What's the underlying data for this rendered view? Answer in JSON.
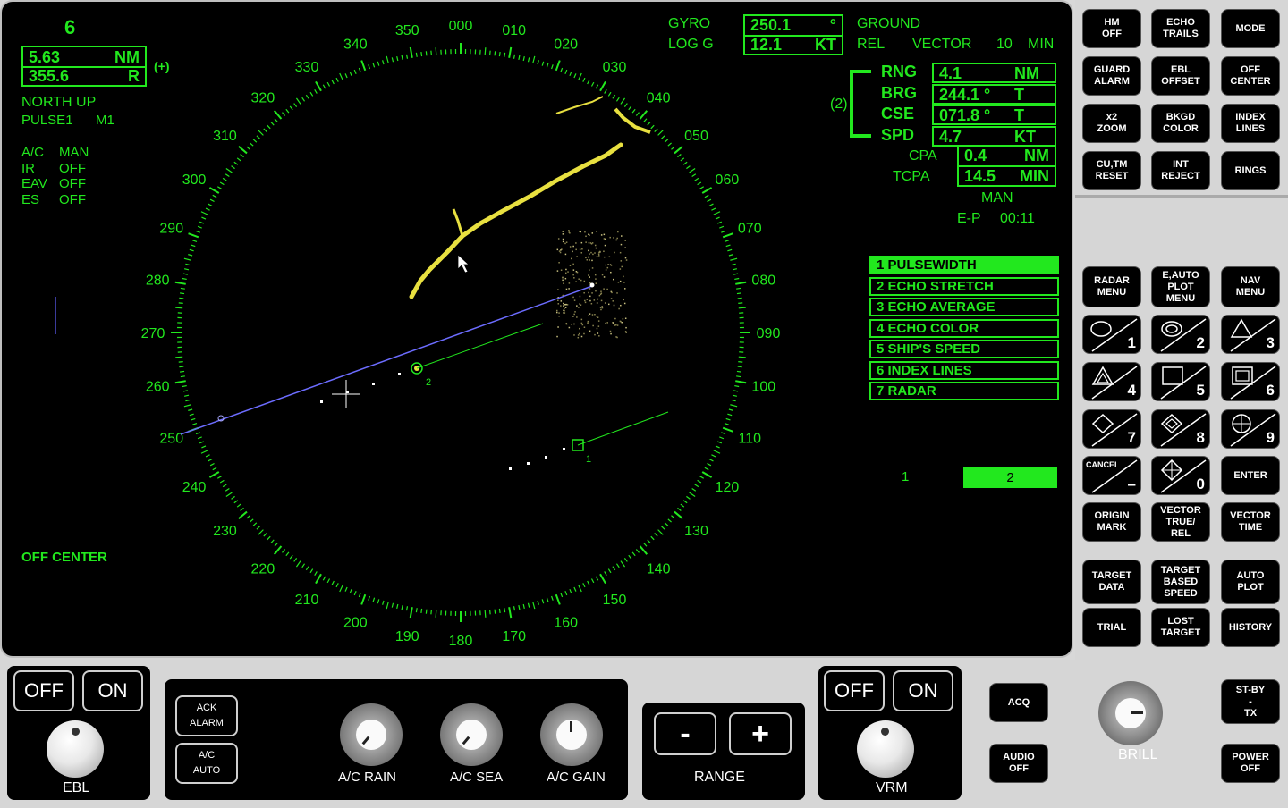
{
  "top_left": {
    "range_scale": "6",
    "range_nm": "5.63",
    "range_nm_unit": "NM",
    "bearing": "355.6",
    "bearing_unit": "R",
    "plus_marker": "(+)",
    "orientation": "NORTH UP",
    "pulse": "PULSE1",
    "mode_m": "M1",
    "settings": [
      {
        "k": "A/C",
        "v": "MAN"
      },
      {
        "k": "IR",
        "v": "OFF"
      },
      {
        "k": "EAV",
        "v": "OFF"
      },
      {
        "k": "ES",
        "v": "OFF"
      }
    ],
    "off_center": "OFF CENTER"
  },
  "heading": {
    "gyro_label": "GYRO",
    "gyro_value": "250.1",
    "gyro_unit": "°",
    "log_label": "LOG G",
    "log_value": "12.1",
    "log_unit": "KT",
    "ground": "GROUND",
    "rel": "REL",
    "vector": "VECTOR",
    "vector_time": "10",
    "vector_unit": "MIN"
  },
  "target": {
    "id": "(2)",
    "rows": [
      {
        "label": "RNG",
        "value": "4.1",
        "unit": "NM"
      },
      {
        "label": "BRG",
        "value": "244.1 °",
        "unit": "T"
      },
      {
        "label": "CSE",
        "value": "071.8 °",
        "unit": "T"
      },
      {
        "label": "SPD",
        "value": "4.7",
        "unit": "KT"
      }
    ],
    "cpa_label": "CPA",
    "cpa_value": "0.4",
    "cpa_unit": "NM",
    "tcpa_label": "TCPA",
    "tcpa_value": "14.5",
    "tcpa_unit": "MIN",
    "man": "MAN",
    "ep_label": "E-P",
    "ep_time": "00:11"
  },
  "menu": {
    "items": [
      "1 PULSEWIDTH",
      "2 ECHO STRETCH",
      "3 ECHO AVERAGE",
      "4 ECHO COLOR",
      "5 SHIP'S SPEED",
      "6 INDEX LINES",
      "7 RADAR"
    ],
    "selected_index": 0,
    "page1": "1",
    "page2": "2"
  },
  "compass": {
    "labels": [
      "000",
      "010",
      "020",
      "030",
      "040",
      "050",
      "060",
      "070",
      "080",
      "090",
      "100",
      "110",
      "120",
      "130",
      "140",
      "150",
      "160",
      "170",
      "180",
      "190",
      "200",
      "210",
      "220",
      "230",
      "240",
      "250",
      "260",
      "270",
      "280",
      "290",
      "300",
      "310",
      "320",
      "330",
      "340",
      "350"
    ]
  },
  "targets_on_screen": {
    "t1": "1",
    "t2": "2"
  },
  "right_buttons": [
    "HM\nOFF",
    "ECHO\nTRAILS",
    "MODE",
    "GUARD\nALARM",
    "EBL\nOFFSET",
    "OFF\nCENTER",
    "x2\nZOOM",
    "BKGD\nCOLOR",
    "INDEX\nLINES",
    "CU,TM\nRESET",
    "INT\nREJECT",
    "RINGS",
    "RADAR\nMENU",
    "E,AUTO\nPLOT\nMENU",
    "NAV\nMENU"
  ],
  "symbol_buttons": {
    "n1": "1",
    "n2": "2",
    "n3": "3",
    "n4": "4",
    "n5": "5",
    "n6": "6",
    "n7": "7",
    "n8": "8",
    "n9": "9",
    "cancel": "CANCEL",
    "cancel_sym": "–",
    "n0": "0",
    "enter": "ENTER"
  },
  "bottom_right_buttons": [
    "ORIGIN\nMARK",
    "VECTOR\nTRUE/\nREL",
    "VECTOR\nTIME",
    "TARGET\nDATA",
    "TARGET\nBASED\nSPEED",
    "AUTO\nPLOT",
    "TRIAL",
    "LOST\nTARGET",
    "HISTORY"
  ],
  "bottom": {
    "ebl_off": "OFF",
    "ebl_on": "ON",
    "ebl_label": "EBL",
    "ack_alarm": "ACK\nALARM",
    "ac_auto": "A/C\nAUTO",
    "ac_rain": "A/C RAIN",
    "ac_sea": "A/C SEA",
    "ac_gain": "A/C GAIN",
    "range_minus": "-",
    "range_plus": "+",
    "range_label": "RANGE",
    "vrm_off": "OFF",
    "vrm_on": "ON",
    "vrm_label": "VRM",
    "acq": "ACQ",
    "audio_off": "AUDIO\nOFF",
    "brill": "BRILL",
    "stby_tx": "ST-BY\n-\nTX",
    "power_off": "POWER\nOFF"
  },
  "colors": {
    "radar_green": "#22e81e",
    "echo_yellow": "#e8e040",
    "ebl_blue": "#6c6cff"
  }
}
